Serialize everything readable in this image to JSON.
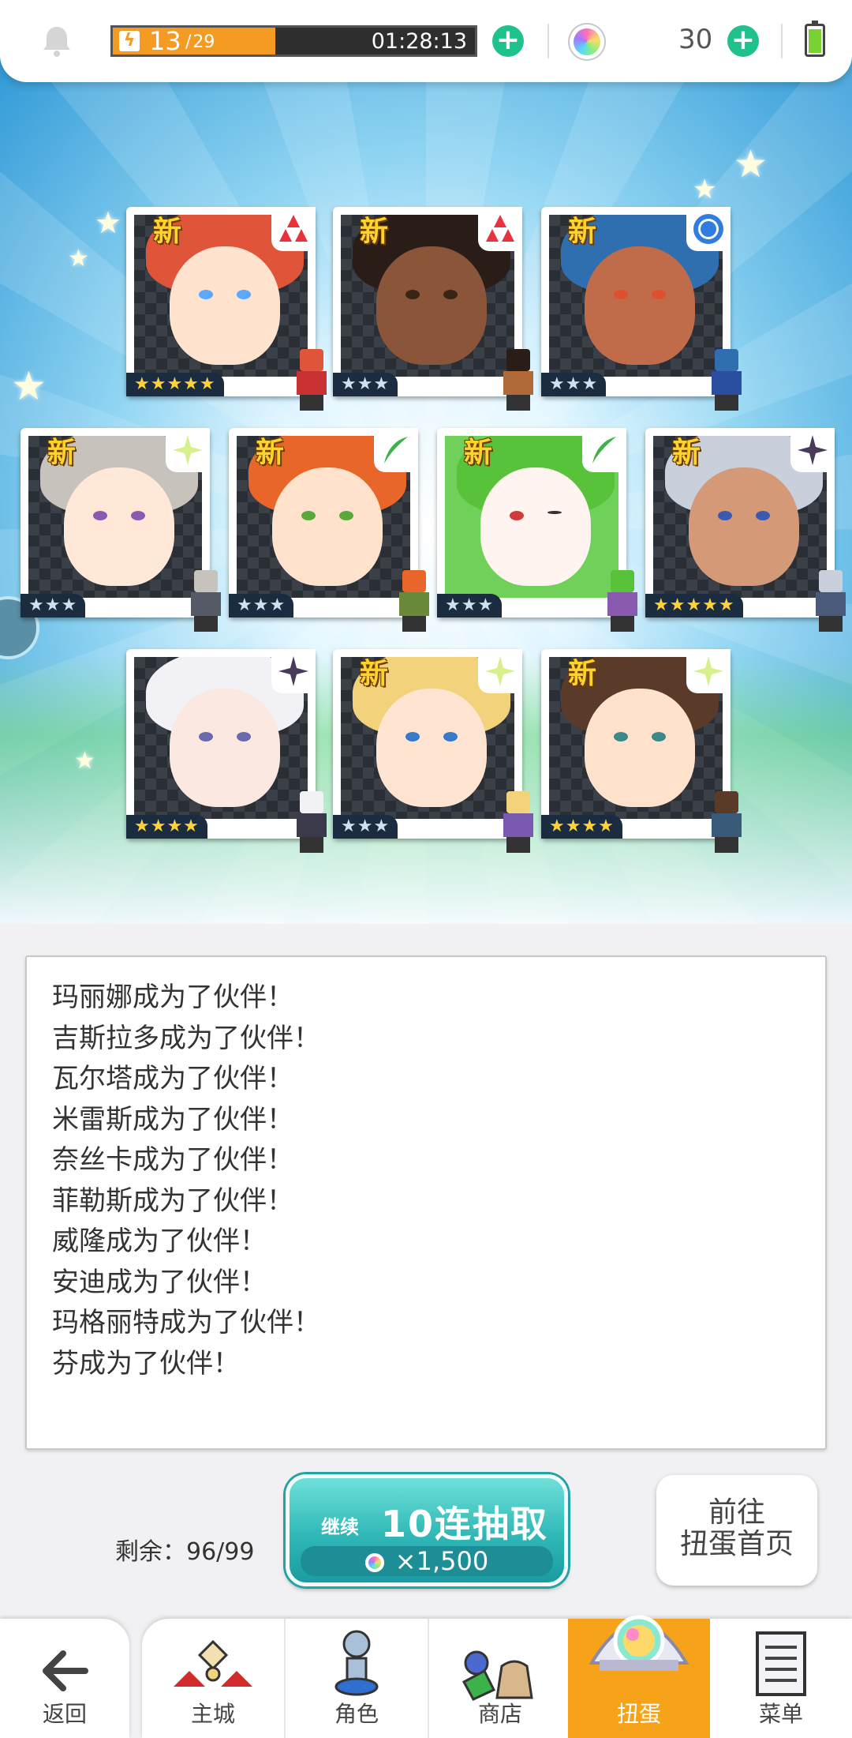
{
  "status_bar": {
    "stamina_current": "13",
    "stamina_max": "29",
    "stamina_fraction": 0.448,
    "timer": "01:28:13",
    "gem_count": "30"
  },
  "cards": [
    {
      "new_label": "新",
      "element": "fire",
      "rarity_stars": "★★★★★",
      "tier": "gold"
    },
    {
      "new_label": "新",
      "element": "fire",
      "rarity_stars": "★★★",
      "tier": "silver"
    },
    {
      "new_label": "新",
      "element": "water",
      "rarity_stars": "★★★",
      "tier": "silver"
    },
    {
      "new_label": "新",
      "element": "light",
      "rarity_stars": "★★★",
      "tier": "silver"
    },
    {
      "new_label": "新",
      "element": "wind",
      "rarity_stars": "★★★",
      "tier": "silver"
    },
    {
      "new_label": "新",
      "element": "wind",
      "rarity_stars": "★★★",
      "tier": "silver"
    },
    {
      "new_label": "新",
      "element": "dark",
      "rarity_stars": "★★★★★",
      "tier": "gold"
    },
    {
      "new_label": "",
      "element": "dark",
      "rarity_stars": "★★★★",
      "tier": "gold"
    },
    {
      "new_label": "新",
      "element": "light",
      "rarity_stars": "★★★",
      "tier": "silver"
    },
    {
      "new_label": "新",
      "element": "light",
      "rarity_stars": "★★★★",
      "tier": "gold"
    }
  ],
  "messages": [
    "玛丽娜成为了伙伴！",
    "吉斯拉多成为了伙伴！",
    "瓦尔塔成为了伙伴！",
    "米雷斯成为了伙伴！",
    "奈丝卡成为了伙伴！",
    "菲勒斯成为了伙伴！",
    "威隆成为了伙伴！",
    "安迪成为了伙伴！",
    "玛格丽特成为了伙伴！",
    "芬成为了伙伴！"
  ],
  "actions": {
    "remaining": "剩余：96/99",
    "continue_label": "继续",
    "gacha_label": "10连抽取",
    "gacha_cost": "×1,500",
    "goto_line1": "前往",
    "goto_line2": "扭蛋首页"
  },
  "nav": {
    "back": "返回",
    "items": [
      "主城",
      "角色",
      "商店",
      "扭蛋",
      "菜单"
    ],
    "active": "扭蛋"
  },
  "colors": {
    "accent_orange": "#f7a31a",
    "button_teal": "#2fb8b7",
    "plus_green": "#1fc18d",
    "fire": "#e8323c",
    "water": "#2f7de0",
    "wind": "#3cb24a",
    "light": "#d8f08a",
    "dark": "#4a3a5a"
  }
}
